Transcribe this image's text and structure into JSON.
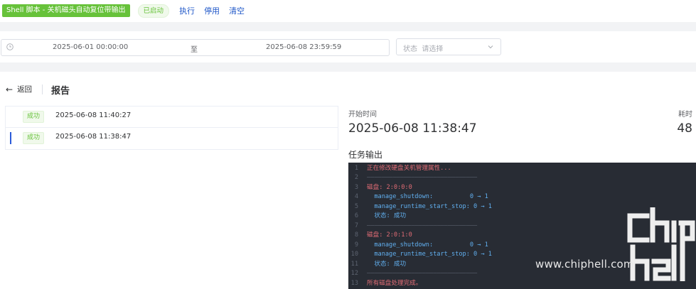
{
  "toolbar": {
    "script_name": "Shell 脚本 - 关机磁头自动复位带输出",
    "status": "已启动",
    "execute_label": "执行",
    "disable_label": "停用",
    "clear_label": "清空"
  },
  "filters": {
    "start_datetime": "2025-06-01 00:00:00",
    "range_separator": "至",
    "end_datetime": "2025-06-08 23:59:59",
    "status_label": "状态",
    "status_placeholder": "请选择"
  },
  "report": {
    "back_label": "返回",
    "title": "报告"
  },
  "runs": [
    {
      "status": "成功",
      "time": "2025-06-08 11:40:27",
      "selected": false
    },
    {
      "status": "成功",
      "time": "2025-06-08 11:38:47",
      "selected": true
    }
  ],
  "detail": {
    "start_label": "开始时间",
    "start_value": "2025-06-08 11:38:47",
    "duration_label": "耗时",
    "duration_value": "48",
    "output_label": "任务输出"
  },
  "console": {
    "lines": [
      {
        "no": "1",
        "text": "正在修改硬盘关机管理属性..."
      },
      {
        "no": "2",
        "text": "——————————————————————————————"
      },
      {
        "no": "3",
        "text": "磁盘: 2:0:0:0"
      },
      {
        "no": "4",
        "text": "  manage_shutdown:          0 → 1"
      },
      {
        "no": "5",
        "text": "  manage_runtime_start_stop: 0 → 1"
      },
      {
        "no": "6",
        "text": "  状态: 成功"
      },
      {
        "no": "7",
        "text": "——————————————————————————————"
      },
      {
        "no": "8",
        "text": "磁盘: 2:0:1:0"
      },
      {
        "no": "9",
        "text": "  manage_shutdown:          0 → 1"
      },
      {
        "no": "10",
        "text": "  manage_runtime_start_stop: 0 → 1"
      },
      {
        "no": "11",
        "text": "  状态: 成功"
      },
      {
        "no": "12",
        "text": "——————————————————————————————"
      },
      {
        "no": "13",
        "text": "所有磁盘处理完成。"
      }
    ]
  },
  "watermark": {
    "text": "www.chiphell.com",
    "logo_text": "chip hell"
  },
  "colors": {
    "success_green": "#67c23a",
    "link_blue": "#1f57c8",
    "console_bg": "#282c34",
    "selected_marker": "#2c5bd9"
  }
}
